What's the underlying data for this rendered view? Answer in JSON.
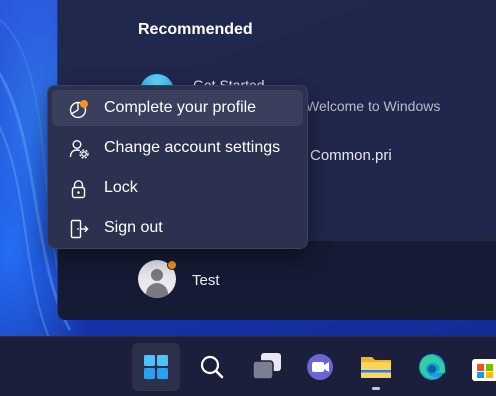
{
  "start_menu": {
    "section_title": "Recommended",
    "recommended": [
      {
        "title": "Get Started",
        "subtitle": "Welcome to Windows"
      },
      {
        "title": "Common.pri"
      }
    ],
    "user": {
      "name": "Test"
    }
  },
  "context_menu": {
    "items": [
      {
        "label": "Complete your profile",
        "icon": "profile-progress-icon"
      },
      {
        "label": "Change account settings",
        "icon": "account-settings-icon"
      },
      {
        "label": "Lock",
        "icon": "lock-icon"
      },
      {
        "label": "Sign out",
        "icon": "sign-out-icon"
      }
    ]
  },
  "taskbar": {
    "items": [
      "start-icon",
      "search-icon",
      "task-view-icon",
      "teams-chat-icon",
      "file-explorer-icon",
      "edge-icon",
      "store-icon"
    ]
  },
  "colors": {
    "accent_orange": "#f7931e",
    "menu_bg": "#2c3150",
    "taskbar_bg": "#1b1f3c"
  }
}
